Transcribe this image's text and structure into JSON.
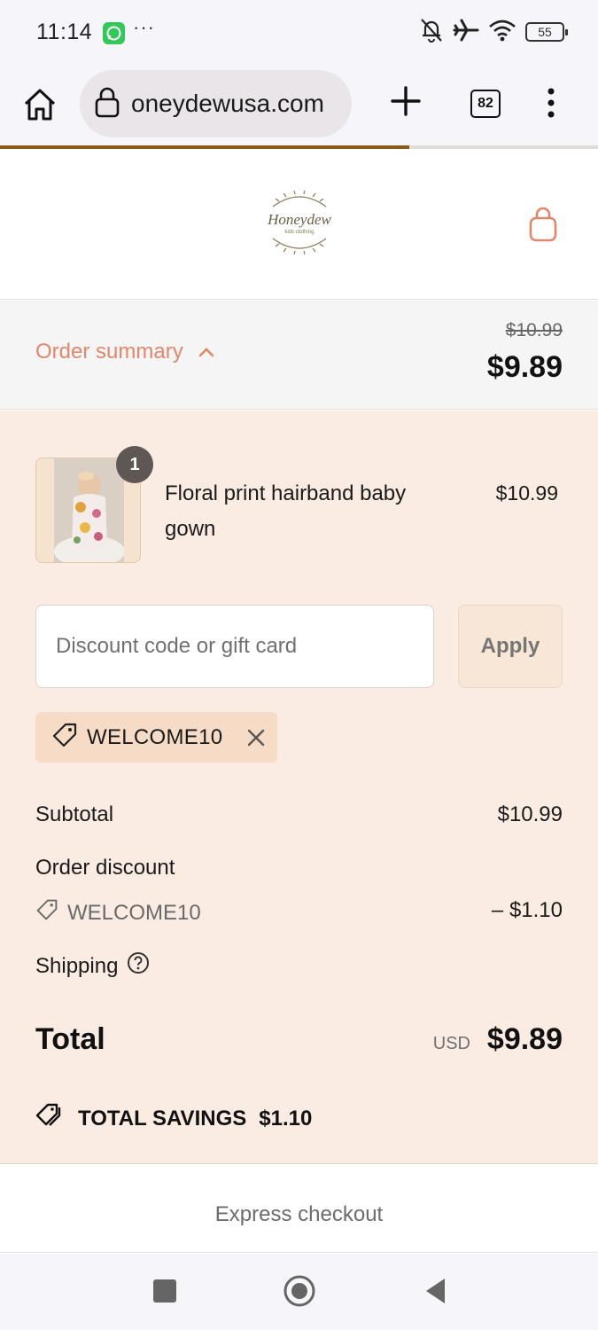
{
  "status_bar": {
    "time": "11:14",
    "dots": "···",
    "battery": "55",
    "icons": [
      "whatsapp-icon",
      "bell-off-icon",
      "airplane-icon",
      "wifi-icon",
      "battery-icon"
    ]
  },
  "browser": {
    "url": "oneydewusa.com",
    "tab_count": "82",
    "load_progress": 0.685
  },
  "header": {
    "logo_text": "Honeydew",
    "logo_subtext": "kids clothing"
  },
  "summary": {
    "toggle_label": "Order summary",
    "original_price": "$10.99",
    "price": "$9.89"
  },
  "product": {
    "quantity": "1",
    "name": "Floral print hairband baby gown",
    "price": "$10.99"
  },
  "discount": {
    "placeholder": "Discount code or gift card",
    "apply_label": "Apply",
    "applied_code": "WELCOME10"
  },
  "totals": {
    "subtotal_label": "Subtotal",
    "subtotal_value": "$10.99",
    "order_discount_label": "Order discount",
    "discount_code": "WELCOME10",
    "discount_value": "– $1.10",
    "shipping_label": "Shipping",
    "total_label": "Total",
    "currency": "USD",
    "total_value": "$9.89",
    "savings_label": "TOTAL SAVINGS",
    "savings_value": "$1.10"
  },
  "express": {
    "label": "Express checkout"
  },
  "colors": {
    "accent": "#e0876c",
    "panel_bg": "#faece2",
    "progress": "#8a5a1a"
  }
}
